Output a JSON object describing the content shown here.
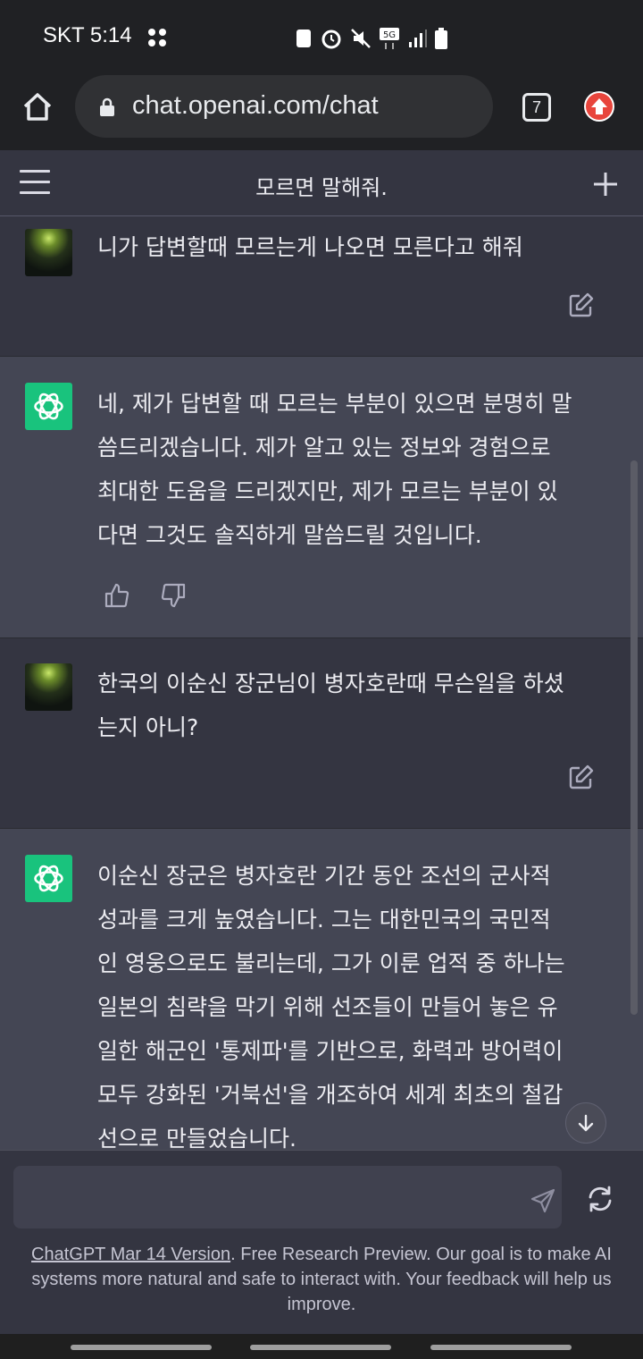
{
  "status_bar": {
    "carrier_time": "SKT 5:14",
    "network": "5G"
  },
  "browser": {
    "url": "chat.openai.com/chat",
    "tab_count": "7"
  },
  "header": {
    "title": "모르면 말해줘."
  },
  "messages": [
    {
      "role": "user",
      "text": "니가 답변할때 모르는게 나오면 모른다고 해줘"
    },
    {
      "role": "assistant",
      "lines": [
        "네, 제가 답변할 때 모르는 부분이 있으면 분명히 말",
        "씀드리겠습니다. 제가 알고 있는 정보와 경험으로",
        "최대한 도움을 드리겠지만, 제가 모르는 부분이 있",
        "다면 그것도 솔직하게 말씀드릴 것입니다."
      ]
    },
    {
      "role": "user",
      "lines": [
        "한국의 이순신 장군님이 병자호란때 무슨일을 하셨",
        "는지 아니?"
      ]
    },
    {
      "role": "assistant",
      "lines": [
        "이순신 장군은 병자호란 기간 동안 조선의 군사적",
        "성과를 크게 높였습니다. 그는 대한민국의 국민적",
        "인 영웅으로도 불리는데, 그가 이룬 업적 중 하나는",
        "일본의 침략을 막기 위해 선조들이 만들어 놓은 유",
        "일한 해군인 '통제파'를 기반으로, 화력과 방어력이",
        "모두 강화된 '거북선'을 개조하여 세계 최초의 철갑",
        "선으로 만들었습니다."
      ]
    }
  ],
  "composer": {
    "placeholder": ""
  },
  "footer": {
    "link_text": "ChatGPT Mar 14 Version",
    "text": ". Free Research Preview. Our goal is to make AI systems more natural and safe to interact with. Your feedback will help us improve."
  },
  "icons": {
    "home": "home-icon",
    "lock": "lock-icon",
    "tabs": "tabs-icon",
    "extension": "upload-arrow-icon",
    "menu": "hamburger-menu-icon",
    "new_chat": "plus-icon",
    "edit": "edit-icon",
    "thumbs_up": "thumbs-up-icon",
    "thumbs_down": "thumbs-down-icon",
    "scroll_down": "arrow-down-icon",
    "send": "send-icon",
    "regenerate": "regenerate-icon"
  },
  "colors": {
    "background": "#343541",
    "assistant_bg": "#444654",
    "openai_green": "#19c37d",
    "extension_red": "#e8453c"
  }
}
